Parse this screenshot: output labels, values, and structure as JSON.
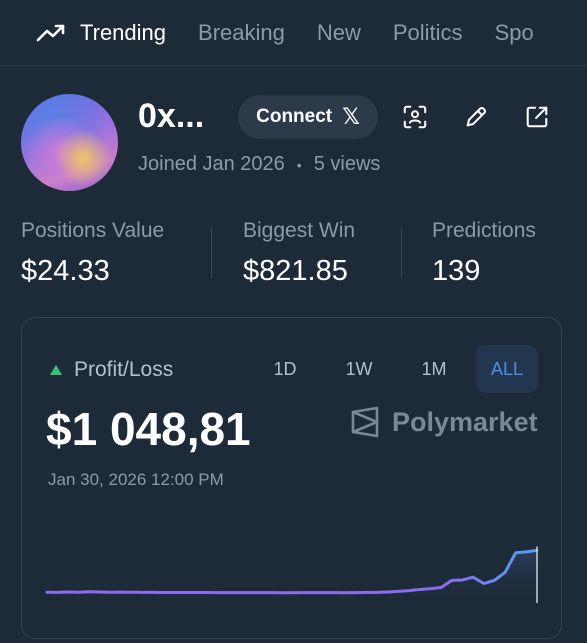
{
  "nav": {
    "tabs": [
      {
        "label": "Trending",
        "icon": "trending-up-icon",
        "active": true
      },
      {
        "label": "Breaking"
      },
      {
        "label": "New"
      },
      {
        "label": "Politics"
      },
      {
        "label": "Spo"
      }
    ]
  },
  "profile": {
    "username": "0x...",
    "connect_label": "Connect",
    "connect_icon": "x-logo-icon",
    "joined": "Joined Jan 2026",
    "views": "5 views"
  },
  "stats": [
    {
      "label": "Positions Value",
      "value": "$24.33"
    },
    {
      "label": "Biggest Win",
      "value": "$821.85"
    },
    {
      "label": "Predictions",
      "value": "139"
    }
  ],
  "pnl": {
    "label": "Profit/Loss",
    "ranges": [
      "1D",
      "1W",
      "1M",
      "ALL"
    ],
    "active_range": "ALL",
    "value": "$1 048,81",
    "date": "Jan 30, 2026 12:00 PM",
    "brand": "Polymarket",
    "line_color": "#8b6cf0",
    "line_end_color": "#4aa3f0",
    "series": [
      0.01,
      0.008,
      0.012,
      0.01,
      0.016,
      0.012,
      0.01,
      0.011,
      0.009,
      0.008,
      0.008,
      0.007,
      0.007,
      0.006,
      0.006,
      0.006,
      0.005,
      0.005,
      0.005,
      0.004,
      0.004,
      0.004,
      0.003,
      0.003,
      0.004,
      0.004,
      0.005,
      0.004,
      0.003,
      0.004,
      0.006,
      0.008,
      0.012,
      0.02,
      0.03,
      0.045,
      0.055,
      0.07,
      0.16,
      0.165,
      0.2,
      0.12,
      0.16,
      0.26,
      0.51,
      0.52,
      0.54
    ]
  },
  "colors": {
    "background": "#1d2b39",
    "muted_text": "#8d9aab",
    "positive": "#3cc07a",
    "accent": "#4a8fe8"
  }
}
